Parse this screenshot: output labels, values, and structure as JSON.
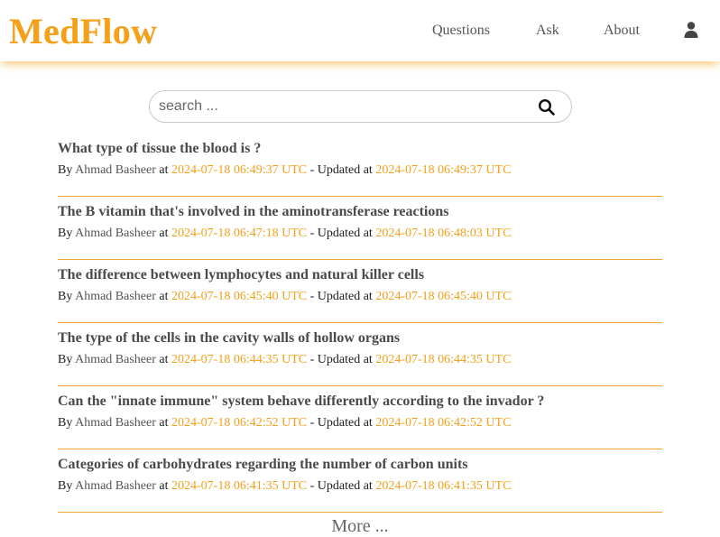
{
  "header": {
    "logo": "MedFlow",
    "nav": {
      "questions": "Questions",
      "ask": "Ask",
      "about": "About"
    },
    "user_icon": "user-icon",
    "accent_color": "#f6a01a"
  },
  "search": {
    "placeholder": "search ...",
    "value": "",
    "icon": "search-icon"
  },
  "questions": [
    {
      "title": "What type of tissue the blood is ?",
      "by_label": "By",
      "author": "Ahmad Basheer",
      "at_label": "at",
      "created": "2024-07-18 06:49:37 UTC",
      "updated_label": "- Updated at",
      "updated": "2024-07-18 06:49:37 UTC"
    },
    {
      "title": "The B vitamin that's involved in the aminotransferase reactions",
      "by_label": "By",
      "author": "Ahmad Basheer",
      "at_label": "at",
      "created": "2024-07-18 06:47:18 UTC",
      "updated_label": "- Updated at",
      "updated": "2024-07-18 06:48:03 UTC"
    },
    {
      "title": "The difference between lymphocytes and natural killer cells",
      "by_label": "By",
      "author": "Ahmad Basheer",
      "at_label": "at",
      "created": "2024-07-18 06:45:40 UTC",
      "updated_label": "- Updated at",
      "updated": "2024-07-18 06:45:40 UTC"
    },
    {
      "title": "The type of the cells in the cavity walls of hollow organs",
      "by_label": "By",
      "author": "Ahmad Basheer",
      "at_label": "at",
      "created": "2024-07-18 06:44:35 UTC",
      "updated_label": "- Updated at",
      "updated": "2024-07-18 06:44:35 UTC"
    },
    {
      "title": "Can the \"innate immune\" system behave differently according to the invador ?",
      "by_label": "By",
      "author": "Ahmad Basheer",
      "at_label": "at",
      "created": "2024-07-18 06:42:52 UTC",
      "updated_label": "- Updated at",
      "updated": "2024-07-18 06:42:52 UTC"
    },
    {
      "title": "Categories of carbohydrates regarding the number of carbon units",
      "by_label": "By",
      "author": "Ahmad Basheer",
      "at_label": "at",
      "created": "2024-07-18 06:41:35 UTC",
      "updated_label": "- Updated at",
      "updated": "2024-07-18 06:41:35 UTC"
    }
  ],
  "more_label": "More ..."
}
